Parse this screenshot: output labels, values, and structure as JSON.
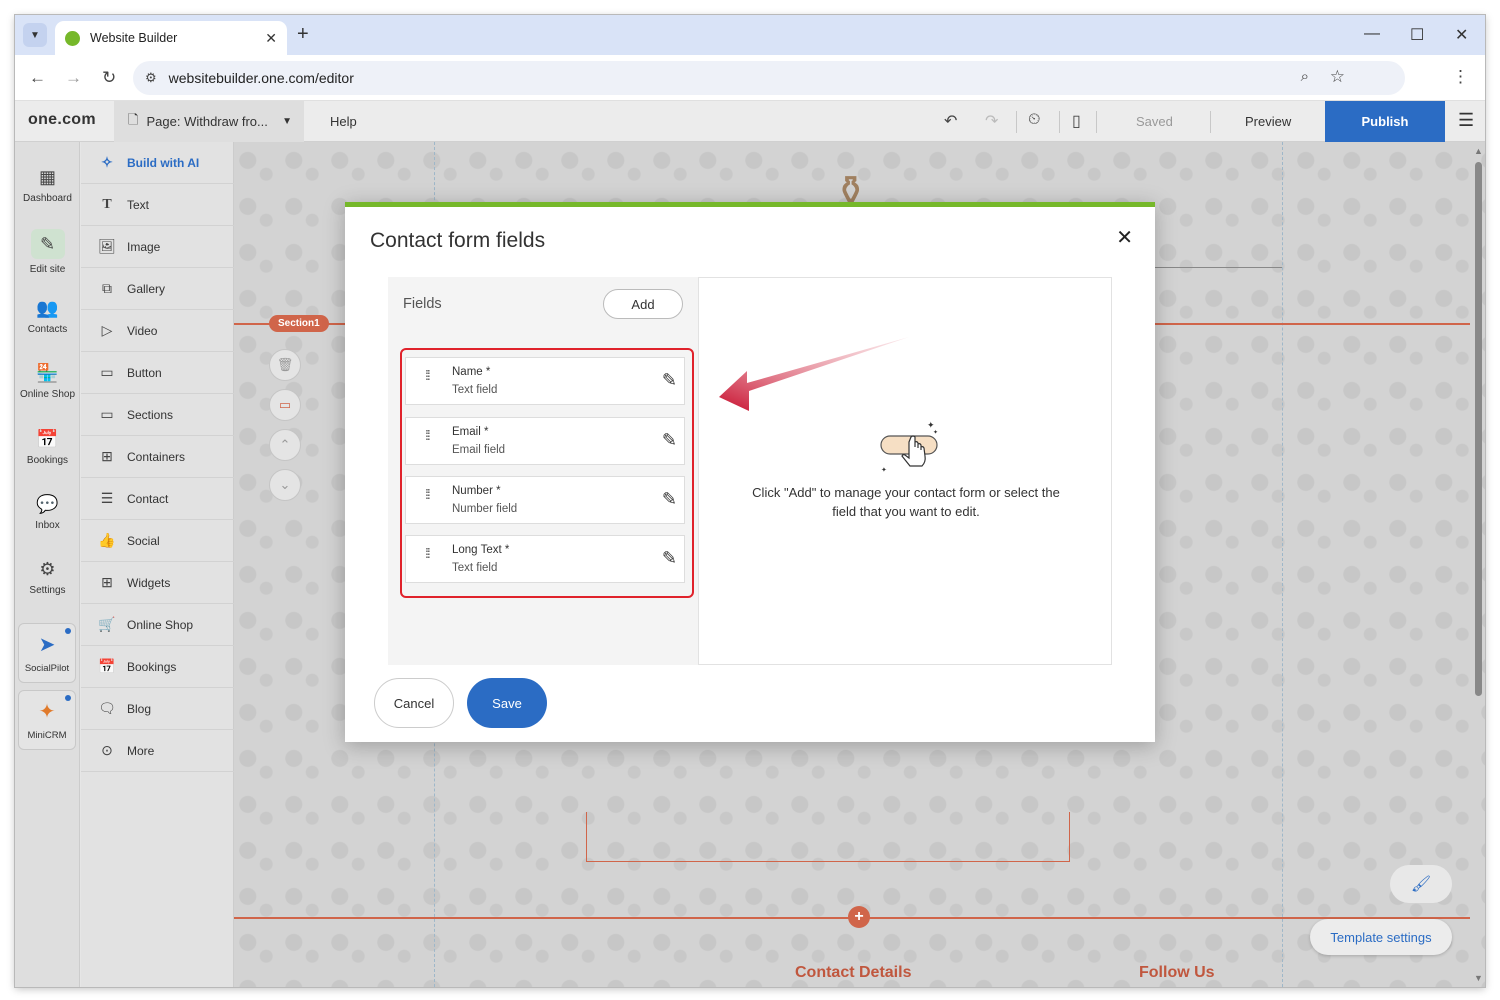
{
  "browser": {
    "tab_title": "Website Builder",
    "url": "websitebuilder.one.com/editor",
    "favicon_color": "#76b82a"
  },
  "editor": {
    "logo": "one.com",
    "page_label": "Page:",
    "page_name": "Withdraw fro...",
    "help": "Help",
    "saved": "Saved",
    "preview": "Preview",
    "publish": "Publish",
    "accent": "#2b6cc4"
  },
  "leftnav": [
    {
      "label": "Dashboard",
      "icon": "dashboard-icon"
    },
    {
      "label": "Edit site",
      "icon": "edit-site-icon"
    },
    {
      "label": "Contacts",
      "icon": "contacts-icon"
    },
    {
      "label": "Online Shop",
      "icon": "shop-icon"
    },
    {
      "label": "Bookings",
      "icon": "bookings-icon"
    },
    {
      "label": "Inbox",
      "icon": "inbox-icon"
    },
    {
      "label": "Settings",
      "icon": "settings-icon"
    }
  ],
  "plugins": [
    {
      "label": "SocialPilot",
      "icon": "socialpilot-icon"
    },
    {
      "label": "MiniCRM",
      "icon": "minicrm-icon"
    }
  ],
  "panel": [
    {
      "label": "Build with AI",
      "icon": "sparkle-icon"
    },
    {
      "label": "Text",
      "icon": "text-icon"
    },
    {
      "label": "Image",
      "icon": "image-icon"
    },
    {
      "label": "Gallery",
      "icon": "gallery-icon"
    },
    {
      "label": "Video",
      "icon": "video-icon"
    },
    {
      "label": "Button",
      "icon": "button-icon"
    },
    {
      "label": "Sections",
      "icon": "sections-icon"
    },
    {
      "label": "Containers",
      "icon": "containers-icon"
    },
    {
      "label": "Contact",
      "icon": "contact-icon"
    },
    {
      "label": "Social",
      "icon": "social-icon"
    },
    {
      "label": "Widgets",
      "icon": "widgets-icon"
    },
    {
      "label": "Online Shop",
      "icon": "cart-icon"
    },
    {
      "label": "Bookings",
      "icon": "bookings-icon"
    },
    {
      "label": "Blog",
      "icon": "blog-icon"
    },
    {
      "label": "More",
      "icon": "more-icon"
    }
  ],
  "canvas": {
    "section_tag": "Section1",
    "contact_details": "Contact Details",
    "follow_us": "Follow Us",
    "template_settings": "Template settings",
    "section_color": "#d0654a"
  },
  "modal": {
    "title": "Contact form fields",
    "fields_heading": "Fields",
    "add": "Add",
    "fields": [
      {
        "label": "Name *",
        "type": "Text field"
      },
      {
        "label": "Email *",
        "type": "Email field"
      },
      {
        "label": "Number *",
        "type": "Number field"
      },
      {
        "label": "Long Text *",
        "type": "Text field"
      }
    ],
    "hint": "Click \"Add\" to manage your contact form or select the field that you want to edit.",
    "cancel": "Cancel",
    "save": "Save",
    "highlight_color": "#e0222b",
    "top_color": "#76b82a"
  }
}
